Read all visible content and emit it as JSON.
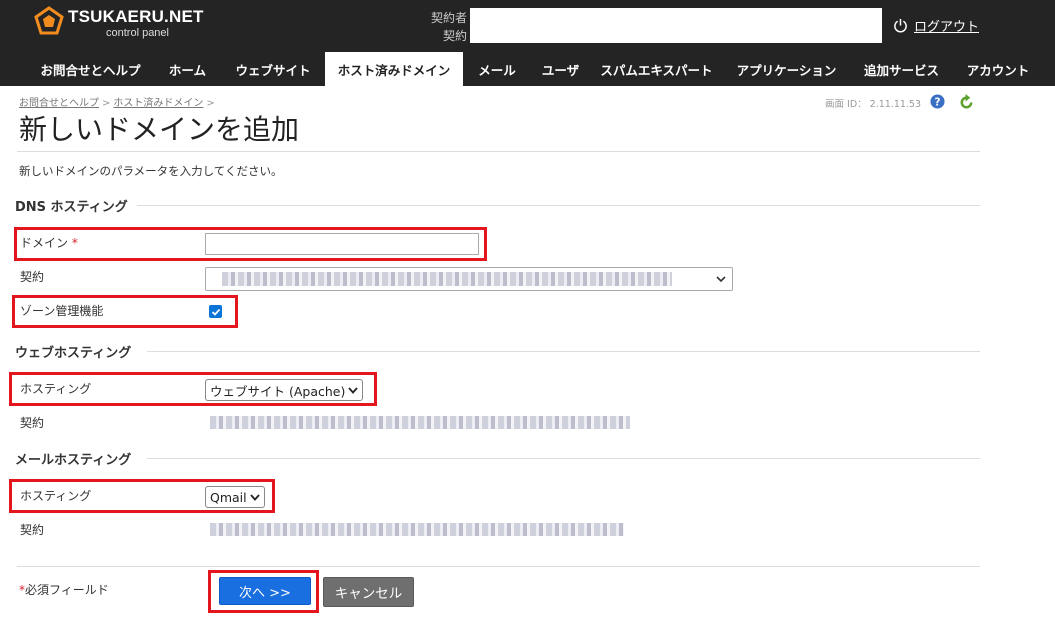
{
  "header": {
    "logo_title": "TSUKAERU.NET",
    "logo_subtitle": "control panel",
    "account_label_1": "契約者",
    "account_label_2": "契約",
    "logout_label": "ログアウト",
    "colors": {
      "bar": "#242424",
      "logo_accent": "#f28c1f"
    }
  },
  "nav": {
    "tabs": [
      {
        "label": "お問合せとヘルプ",
        "active": false
      },
      {
        "label": "ホーム",
        "active": false
      },
      {
        "label": "ウェブサイト",
        "active": false
      },
      {
        "label": "ホスト済みドメイン",
        "active": true
      },
      {
        "label": "メール",
        "active": false
      },
      {
        "label": "ユーザ",
        "active": false
      },
      {
        "label": "スパムエキスパート",
        "active": false
      },
      {
        "label": "アプリケーション",
        "active": false
      },
      {
        "label": "追加サービス",
        "active": false
      },
      {
        "label": "アカウント",
        "active": false
      }
    ]
  },
  "breadcrumb": {
    "items": [
      "お問合せとヘルプ",
      "ホスト済みドメイン"
    ],
    "separator": ">"
  },
  "screen_id": "画面 ID： 2.11.11.53",
  "page": {
    "title": "新しいドメインを追加",
    "intro": "新しいドメインのパラメータを入力してください。"
  },
  "sections": {
    "dns": {
      "title": "DNS ホスティング",
      "domain_label": "ドメイン",
      "domain_value": "",
      "contract_label": "契約",
      "zone_label": "ゾーン管理機能",
      "zone_checked": true
    },
    "web": {
      "title": "ウェブホスティング",
      "hosting_label": "ホスティング",
      "hosting_value": "ウェブサイト (Apache)",
      "contract_label": "契約"
    },
    "mail": {
      "title": "メールホスティング",
      "hosting_label": "ホスティング",
      "hosting_value": "Qmail",
      "contract_label": "契約"
    }
  },
  "footer": {
    "required_mark": "*",
    "required_note": "必須フィールド",
    "next_label": "次へ >>",
    "cancel_label": "キャンセル"
  },
  "colors": {
    "highlight": "#e3151d",
    "primary_button": "#1a6fe0",
    "secondary_button": "#6f6f6f",
    "required": "#d9232d"
  },
  "icons": [
    "logo-pentagon-icon",
    "power-icon",
    "help-icon",
    "refresh-icon",
    "chevron-down-icon",
    "check-icon"
  ]
}
